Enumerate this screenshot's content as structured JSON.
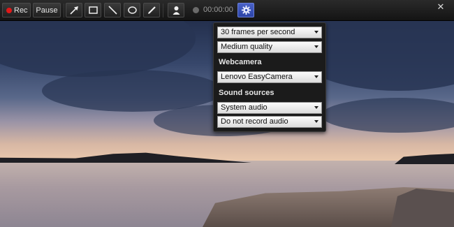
{
  "toolbar": {
    "rec_label": "Rec",
    "pause_label": "Pause",
    "tools": [
      "arrow-tool",
      "rectangle-tool",
      "line-tool",
      "ellipse-tool",
      "pen-tool",
      "webcam-person-tool"
    ],
    "timer": "00:00:00",
    "close": "✕"
  },
  "settings_panel": {
    "frame_rate": "30 frames per second",
    "quality": "Medium quality",
    "webcamera_heading": "Webcamera",
    "webcamera": "Lenovo EasyCamera",
    "sound_heading": "Sound sources",
    "system_audio": "System audio",
    "mic_audio": "Do not record audio"
  },
  "colors": {
    "rec_dot": "#e01818",
    "gear_button": "#3a52b8",
    "toolbar": "#1c1c1c",
    "panel": "#1b1b1b"
  }
}
